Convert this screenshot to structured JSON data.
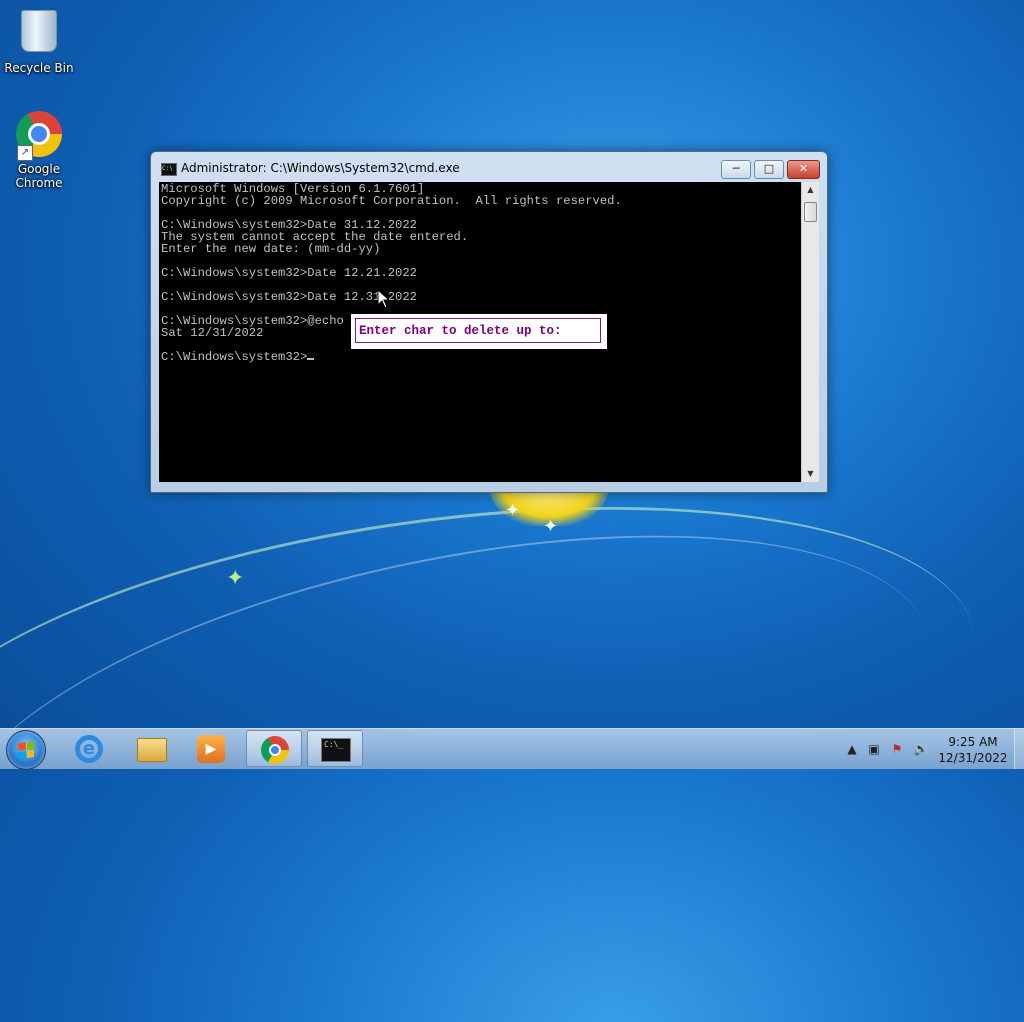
{
  "desktop": {
    "icons": [
      {
        "label": "Recycle Bin",
        "icon": "recycle-bin-icon"
      },
      {
        "label": "Google\nChrome",
        "icon": "chrome-icon"
      }
    ]
  },
  "window": {
    "title": "Administrator: C:\\Windows\\System32\\cmd.exe",
    "controls": {
      "minimize": "─",
      "maximize": "□",
      "close": "✕"
    },
    "console_lines": [
      "Microsoft Windows [Version 6.1.7601]",
      "Copyright (c) 2009 Microsoft Corporation.  All rights reserved.",
      "",
      "C:\\Windows\\system32>Date 31.12.2022",
      "The system cannot accept the date entered.",
      "Enter the new date: (mm-dd-yy)",
      "",
      "C:\\Windows\\system32>Date 12.21.2022",
      "",
      "C:\\Windows\\system32>Date 12.31.2022",
      "",
      "C:\\Windows\\system32>@echo",
      "Sat 12/31/2022",
      "",
      "C:\\Windows\\system32>"
    ]
  },
  "popup": {
    "text": "Enter char to delete up to:"
  },
  "taskbar": {
    "apps": [
      {
        "name": "internet-explorer",
        "icon": "ie-icon"
      },
      {
        "name": "windows-explorer",
        "icon": "folder-icon"
      },
      {
        "name": "media-player",
        "icon": "media-player-icon"
      },
      {
        "name": "google-chrome",
        "icon": "chrome-icon"
      },
      {
        "name": "command-prompt",
        "icon": "cmd-icon",
        "label": "C:\\_",
        "active": true
      }
    ],
    "clock": {
      "time": "9:25 AM",
      "date": "12/31/2022"
    }
  },
  "colors": {
    "console_bg": "#000000",
    "console_text": "#c0c0c0",
    "popup_text": "#800080",
    "close_button": "#c7402a"
  }
}
